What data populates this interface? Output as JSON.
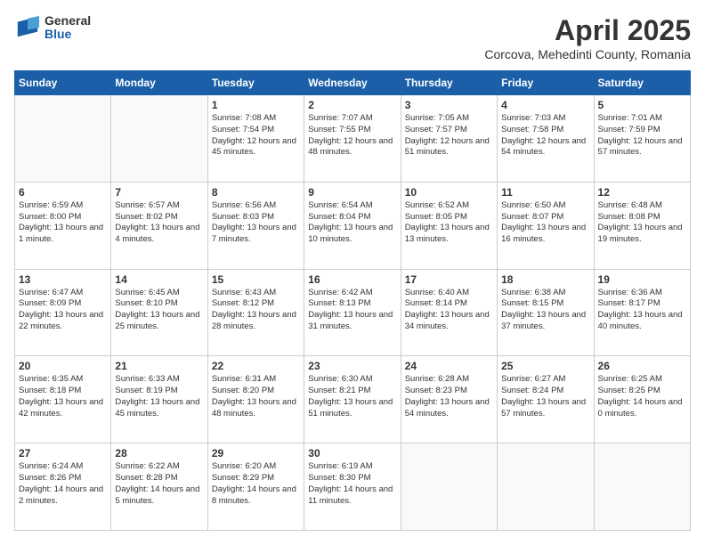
{
  "header": {
    "logo_general": "General",
    "logo_blue": "Blue",
    "month_title": "April 2025",
    "subtitle": "Corcova, Mehedinti County, Romania"
  },
  "days_of_week": [
    "Sunday",
    "Monday",
    "Tuesday",
    "Wednesday",
    "Thursday",
    "Friday",
    "Saturday"
  ],
  "cells": [
    {
      "day": "",
      "text": ""
    },
    {
      "day": "",
      "text": ""
    },
    {
      "day": "1",
      "text": "Sunrise: 7:08 AM\nSunset: 7:54 PM\nDaylight: 12 hours and 45 minutes."
    },
    {
      "day": "2",
      "text": "Sunrise: 7:07 AM\nSunset: 7:55 PM\nDaylight: 12 hours and 48 minutes."
    },
    {
      "day": "3",
      "text": "Sunrise: 7:05 AM\nSunset: 7:57 PM\nDaylight: 12 hours and 51 minutes."
    },
    {
      "day": "4",
      "text": "Sunrise: 7:03 AM\nSunset: 7:58 PM\nDaylight: 12 hours and 54 minutes."
    },
    {
      "day": "5",
      "text": "Sunrise: 7:01 AM\nSunset: 7:59 PM\nDaylight: 12 hours and 57 minutes."
    },
    {
      "day": "6",
      "text": "Sunrise: 6:59 AM\nSunset: 8:00 PM\nDaylight: 13 hours and 1 minute."
    },
    {
      "day": "7",
      "text": "Sunrise: 6:57 AM\nSunset: 8:02 PM\nDaylight: 13 hours and 4 minutes."
    },
    {
      "day": "8",
      "text": "Sunrise: 6:56 AM\nSunset: 8:03 PM\nDaylight: 13 hours and 7 minutes."
    },
    {
      "day": "9",
      "text": "Sunrise: 6:54 AM\nSunset: 8:04 PM\nDaylight: 13 hours and 10 minutes."
    },
    {
      "day": "10",
      "text": "Sunrise: 6:52 AM\nSunset: 8:05 PM\nDaylight: 13 hours and 13 minutes."
    },
    {
      "day": "11",
      "text": "Sunrise: 6:50 AM\nSunset: 8:07 PM\nDaylight: 13 hours and 16 minutes."
    },
    {
      "day": "12",
      "text": "Sunrise: 6:48 AM\nSunset: 8:08 PM\nDaylight: 13 hours and 19 minutes."
    },
    {
      "day": "13",
      "text": "Sunrise: 6:47 AM\nSunset: 8:09 PM\nDaylight: 13 hours and 22 minutes."
    },
    {
      "day": "14",
      "text": "Sunrise: 6:45 AM\nSunset: 8:10 PM\nDaylight: 13 hours and 25 minutes."
    },
    {
      "day": "15",
      "text": "Sunrise: 6:43 AM\nSunset: 8:12 PM\nDaylight: 13 hours and 28 minutes."
    },
    {
      "day": "16",
      "text": "Sunrise: 6:42 AM\nSunset: 8:13 PM\nDaylight: 13 hours and 31 minutes."
    },
    {
      "day": "17",
      "text": "Sunrise: 6:40 AM\nSunset: 8:14 PM\nDaylight: 13 hours and 34 minutes."
    },
    {
      "day": "18",
      "text": "Sunrise: 6:38 AM\nSunset: 8:15 PM\nDaylight: 13 hours and 37 minutes."
    },
    {
      "day": "19",
      "text": "Sunrise: 6:36 AM\nSunset: 8:17 PM\nDaylight: 13 hours and 40 minutes."
    },
    {
      "day": "20",
      "text": "Sunrise: 6:35 AM\nSunset: 8:18 PM\nDaylight: 13 hours and 42 minutes."
    },
    {
      "day": "21",
      "text": "Sunrise: 6:33 AM\nSunset: 8:19 PM\nDaylight: 13 hours and 45 minutes."
    },
    {
      "day": "22",
      "text": "Sunrise: 6:31 AM\nSunset: 8:20 PM\nDaylight: 13 hours and 48 minutes."
    },
    {
      "day": "23",
      "text": "Sunrise: 6:30 AM\nSunset: 8:21 PM\nDaylight: 13 hours and 51 minutes."
    },
    {
      "day": "24",
      "text": "Sunrise: 6:28 AM\nSunset: 8:23 PM\nDaylight: 13 hours and 54 minutes."
    },
    {
      "day": "25",
      "text": "Sunrise: 6:27 AM\nSunset: 8:24 PM\nDaylight: 13 hours and 57 minutes."
    },
    {
      "day": "26",
      "text": "Sunrise: 6:25 AM\nSunset: 8:25 PM\nDaylight: 14 hours and 0 minutes."
    },
    {
      "day": "27",
      "text": "Sunrise: 6:24 AM\nSunset: 8:26 PM\nDaylight: 14 hours and 2 minutes."
    },
    {
      "day": "28",
      "text": "Sunrise: 6:22 AM\nSunset: 8:28 PM\nDaylight: 14 hours and 5 minutes."
    },
    {
      "day": "29",
      "text": "Sunrise: 6:20 AM\nSunset: 8:29 PM\nDaylight: 14 hours and 8 minutes."
    },
    {
      "day": "30",
      "text": "Sunrise: 6:19 AM\nSunset: 8:30 PM\nDaylight: 14 hours and 11 minutes."
    },
    {
      "day": "",
      "text": ""
    },
    {
      "day": "",
      "text": ""
    },
    {
      "day": "",
      "text": ""
    }
  ]
}
